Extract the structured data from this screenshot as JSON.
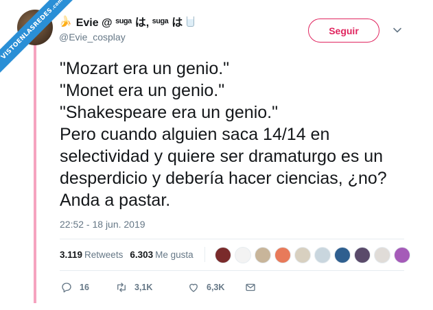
{
  "watermark": {
    "text": "VISTOENLASREDES",
    "sub": ".com"
  },
  "author": {
    "display_name": "Evie @ ˢᵘᵍᵃ は, ˢᵘᵍᵃ は",
    "handle": "@Evie_cosplay"
  },
  "follow_button": {
    "label": "Seguir"
  },
  "tweet": {
    "text": "\"Mozart era un genio.\"\n\"Monet era un genio.\"\n\"Shakespeare era un genio.\"\nPero cuando alguien saca 14/14 en selectividad y quiere ser dramaturgo es un desperdicio y debería hacer ciencias, ¿no? Anda a pastar.",
    "timestamp": "22:52 - 18 jun. 2019"
  },
  "stats": {
    "retweets": {
      "count": "3.119",
      "label": "Retweets"
    },
    "likes": {
      "count": "6.303",
      "label": "Me gusta"
    }
  },
  "likers": [
    {
      "color": "#7a2b2b"
    },
    {
      "color": "#f3f3f3"
    },
    {
      "color": "#c8b59a"
    },
    {
      "color": "#e87a5a"
    },
    {
      "color": "#d8d0c0"
    },
    {
      "color": "#c9d6de"
    },
    {
      "color": "#2f5f8f"
    },
    {
      "color": "#5a4a6a"
    },
    {
      "color": "#e0dcd8"
    },
    {
      "color": "#a55bb8"
    }
  ],
  "actions": {
    "replies": "16",
    "retweets": "3,1K",
    "likes": "6,3K"
  },
  "colors": {
    "accent": "#e0245e",
    "thread": "#f5a3bf",
    "muted": "#657786"
  }
}
